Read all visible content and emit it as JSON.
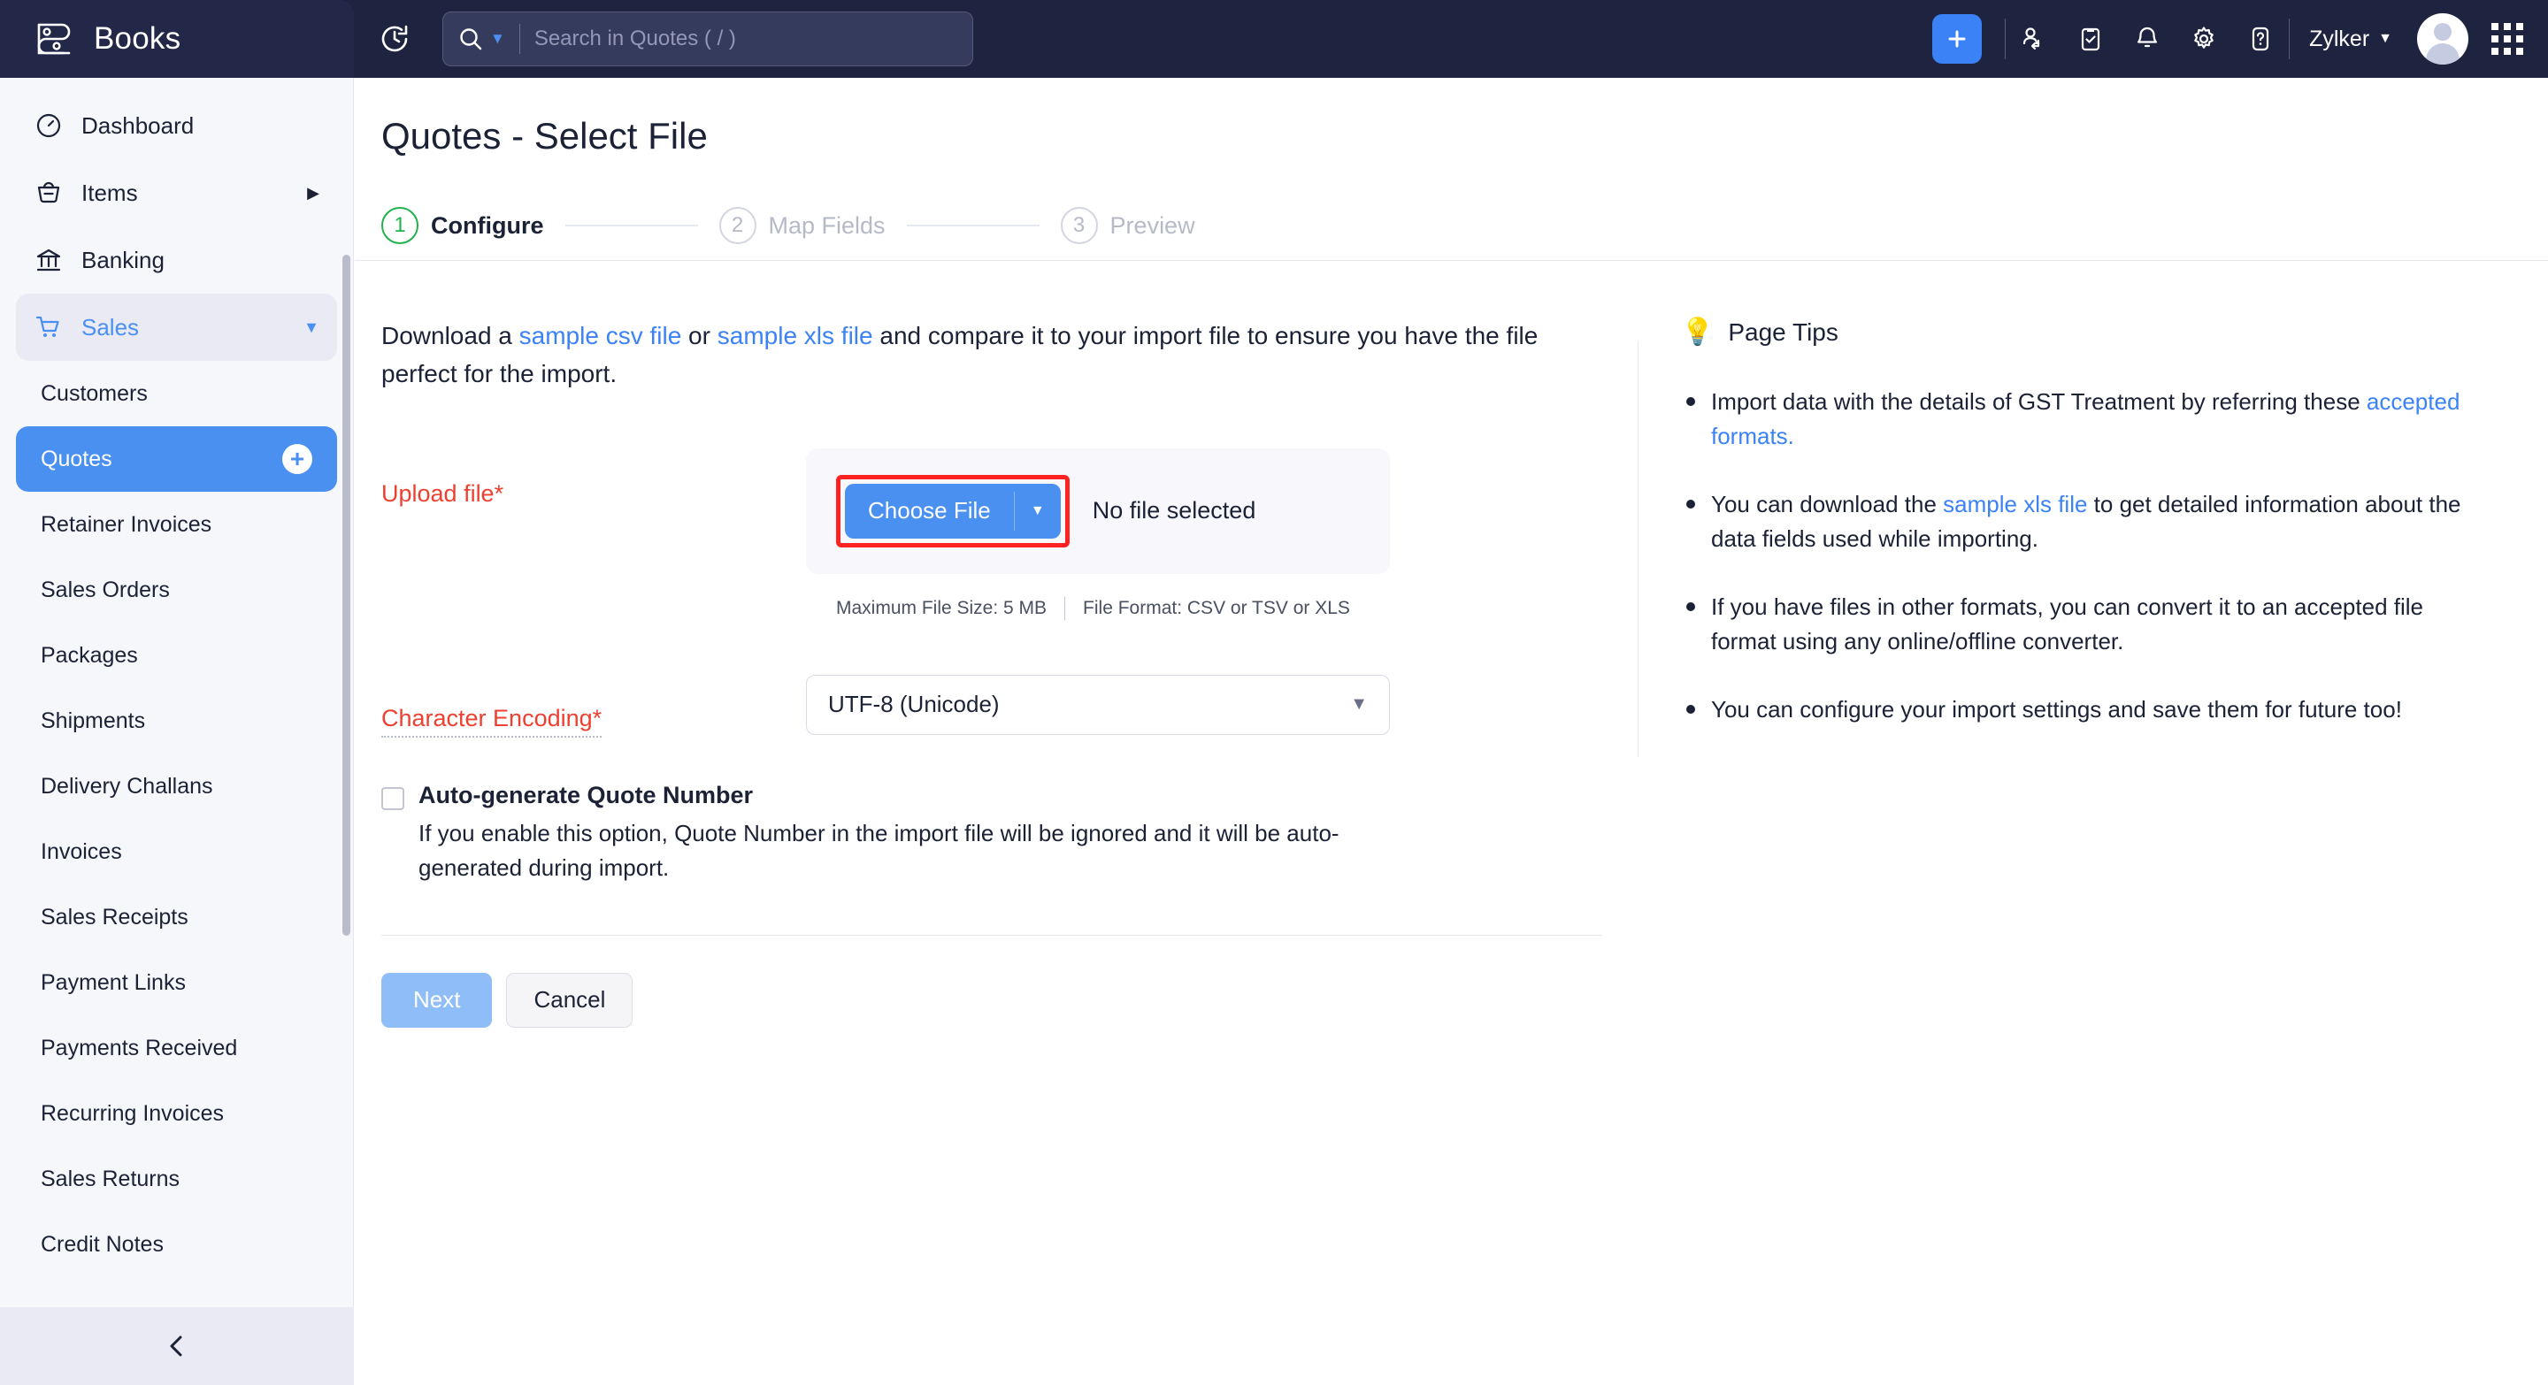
{
  "app": {
    "brand_name": "Books",
    "brand_logo_icon": "books-logo-icon",
    "refresh_icon": "refresh-clock-icon"
  },
  "search": {
    "placeholder": "Search in Quotes ( / )",
    "value": "",
    "icon": "search-icon",
    "dropdown_icon": "chevron-down-icon"
  },
  "header": {
    "add_icon": "plus-icon",
    "referral_icon": "referral-users-icon",
    "tasks_icon": "clipboard-check-icon",
    "notifications_icon": "bell-icon",
    "settings_icon": "gear-icon",
    "help_icon": "help-question-icon",
    "org_name": "Zylker",
    "org_caret_icon": "chevron-down-icon",
    "avatar_icon": "user-avatar",
    "apps_icon": "apps-grid-icon"
  },
  "sidebar": {
    "nav": [
      {
        "label": "Dashboard",
        "icon": "gauge-icon",
        "arrow": ""
      },
      {
        "label": "Items",
        "icon": "basket-icon",
        "arrow": "▶"
      },
      {
        "label": "Banking",
        "icon": "bank-icon",
        "arrow": ""
      },
      {
        "label": "Sales",
        "icon": "shopping-cart-icon",
        "arrow": "▼"
      }
    ],
    "sub_items": [
      {
        "label": "Customers",
        "active": false
      },
      {
        "label": "Quotes",
        "active": true,
        "plus": "+"
      },
      {
        "label": "Retainer Invoices",
        "active": false
      },
      {
        "label": "Sales Orders",
        "active": false
      },
      {
        "label": "Packages",
        "active": false
      },
      {
        "label": "Shipments",
        "active": false
      },
      {
        "label": "Delivery Challans",
        "active": false
      },
      {
        "label": "Invoices",
        "active": false
      },
      {
        "label": "Sales Receipts",
        "active": false
      },
      {
        "label": "Payment Links",
        "active": false
      },
      {
        "label": "Payments Received",
        "active": false
      },
      {
        "label": "Recurring Invoices",
        "active": false
      },
      {
        "label": "Sales Returns",
        "active": false
      },
      {
        "label": "Credit Notes",
        "active": false
      }
    ],
    "collapse_icon": "chevron-left-icon"
  },
  "main": {
    "page_title": "Quotes - Select File",
    "steps": [
      {
        "num": "1",
        "label": "Configure",
        "active": true
      },
      {
        "num": "2",
        "label": "Map Fields",
        "active": false
      },
      {
        "num": "3",
        "label": "Preview",
        "active": false
      }
    ],
    "intro": {
      "part1": "Download a ",
      "link_csv": "sample csv file",
      "part2": " or ",
      "link_xls": "sample xls file",
      "part3": " and compare it to your import file to ensure you have the file perfect for the import."
    },
    "upload": {
      "label": "Upload file*",
      "choose_button": "Choose File",
      "choose_caret_icon": "caret-down-icon",
      "no_file_text": "No file selected",
      "max_size": "Maximum File Size: 5 MB",
      "file_format": "File Format: CSV or TSV or XLS",
      "highlight_color": "#ff2222"
    },
    "encoding": {
      "label": "Character Encoding*",
      "value": "UTF-8 (Unicode)",
      "caret_icon": "chevron-down-icon"
    },
    "autogen": {
      "checked": false,
      "title": "Auto-generate Quote Number",
      "description": "If you enable this option, Quote Number in the import file will be ignored and it will be auto-generated during import."
    },
    "actions": {
      "next": "Next",
      "cancel": "Cancel"
    }
  },
  "tips": {
    "bulb_icon": "lightbulb-icon",
    "title": "Page Tips",
    "items": [
      {
        "text_before": "Import data with the details of GST Treatment by referring these ",
        "link": "accepted formats.",
        "text_after": ""
      },
      {
        "text_before": "You can download the ",
        "link": "sample xls file",
        "text_after": " to get detailed information about the data fields used while importing."
      },
      {
        "text_before": "If you have files in other formats, you can convert it to an accepted file format using any online/offline converter.",
        "link": "",
        "text_after": ""
      },
      {
        "text_before": "You can configure your import settings and save them for future too!",
        "link": "",
        "text_after": ""
      }
    ]
  },
  "colors": {
    "header_bg": "#1e2340",
    "accent_blue": "#4a90f0",
    "active_green": "#22b24c",
    "required_red": "#ec4030"
  }
}
